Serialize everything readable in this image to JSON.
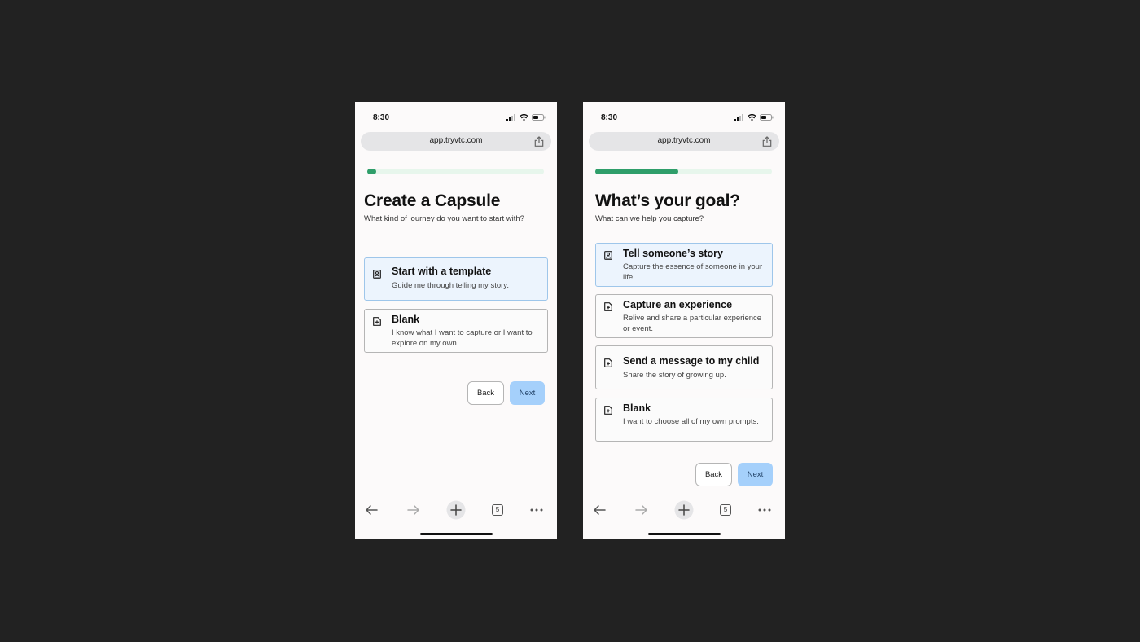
{
  "screens": [
    {
      "status_time": "8:30",
      "url": "app.tryvtc.com",
      "progress": 0.05,
      "title": "Create a Capsule",
      "subtitle": "What kind of journey do you want to start with?",
      "options": [
        {
          "title": "Start with a template",
          "desc": "Guide me through telling my story.",
          "icon": "person-book-icon",
          "selected": true
        },
        {
          "title": "Blank",
          "desc": "I know what I want to capture or I want to explore on my own.",
          "icon": "document-plus-icon",
          "selected": false
        }
      ],
      "back_label": "Back",
      "next_label": "Next",
      "tab_count": "5"
    },
    {
      "status_time": "8:30",
      "url": "app.tryvtc.com",
      "progress": 0.47,
      "title": "What’s your goal?",
      "subtitle": "What can we help you capture?",
      "options": [
        {
          "title": "Tell someone’s story",
          "desc": "Capture the essence of someone in your life.",
          "icon": "person-book-icon",
          "selected": true
        },
        {
          "title": "Capture an experience",
          "desc": "Relive and share a particular experience or event.",
          "icon": "document-plus-icon",
          "selected": false
        },
        {
          "title": "Send a message to my child",
          "desc": "Share the story of growing up.",
          "icon": "document-plus-icon",
          "selected": false
        },
        {
          "title": "Blank",
          "desc": "I want to choose all of my own prompts.",
          "icon": "document-plus-icon",
          "selected": false
        }
      ],
      "back_label": "Back",
      "next_label": "Next",
      "tab_count": "5"
    }
  ],
  "colors": {
    "progress_fill": "#2f9e6a",
    "progress_track": "#e7f6ec",
    "selected_bg": "#ecf4fd",
    "selected_border": "#9ec6ea",
    "next_button": "#a5d0fb"
  }
}
